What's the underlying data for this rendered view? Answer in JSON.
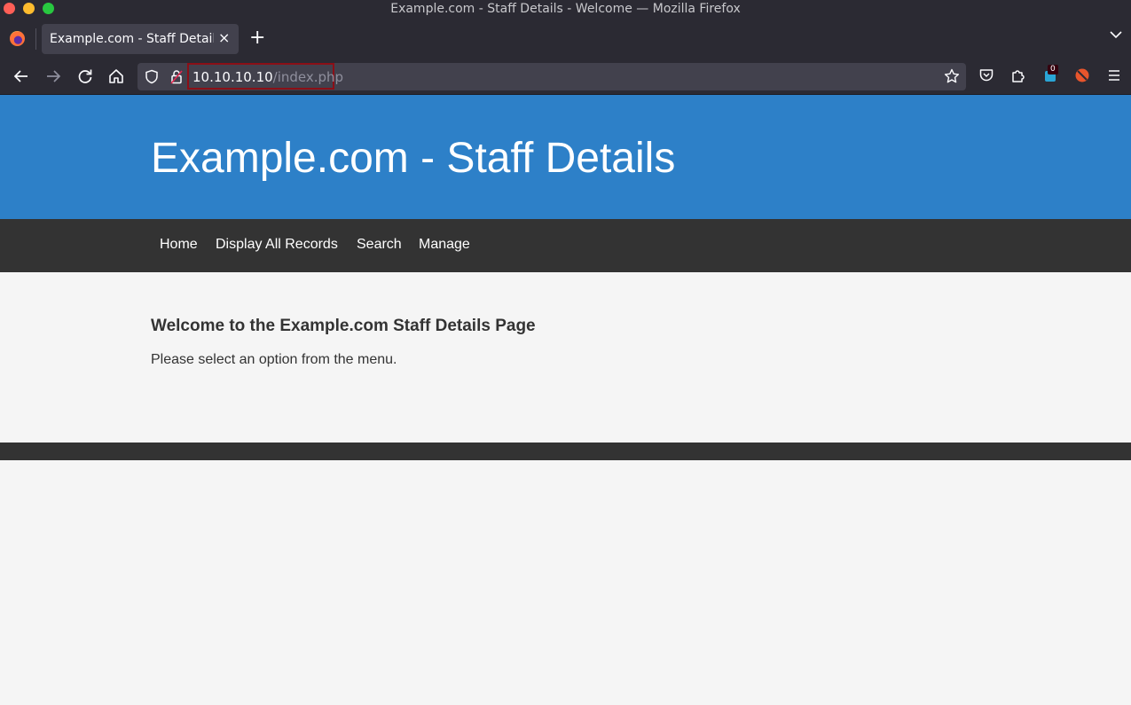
{
  "window": {
    "title": "Example.com - Staff Details - Welcome — Mozilla Firefox"
  },
  "tabs": [
    {
      "label": "Example.com - Staff Details",
      "active": true
    }
  ],
  "toolbar": {
    "new_tab_label": "+",
    "close_tab_label": "×"
  },
  "urlbar": {
    "host": "10.10.10.10",
    "path": "/index.php"
  },
  "extensions": {
    "badge_count": "0"
  },
  "site": {
    "title": "Example.com - Staff Details",
    "nav": [
      {
        "label": "Home"
      },
      {
        "label": "Display All Records"
      },
      {
        "label": "Search"
      },
      {
        "label": "Manage"
      }
    ],
    "welcome_heading": "Welcome to the Example.com Staff Details Page",
    "welcome_text": "Please select an option from the menu."
  },
  "colors": {
    "header_bg": "#2d80c8",
    "nav_bg": "#333333",
    "page_bg": "#f5f5f5",
    "url_highlight": "#8b0f17"
  }
}
